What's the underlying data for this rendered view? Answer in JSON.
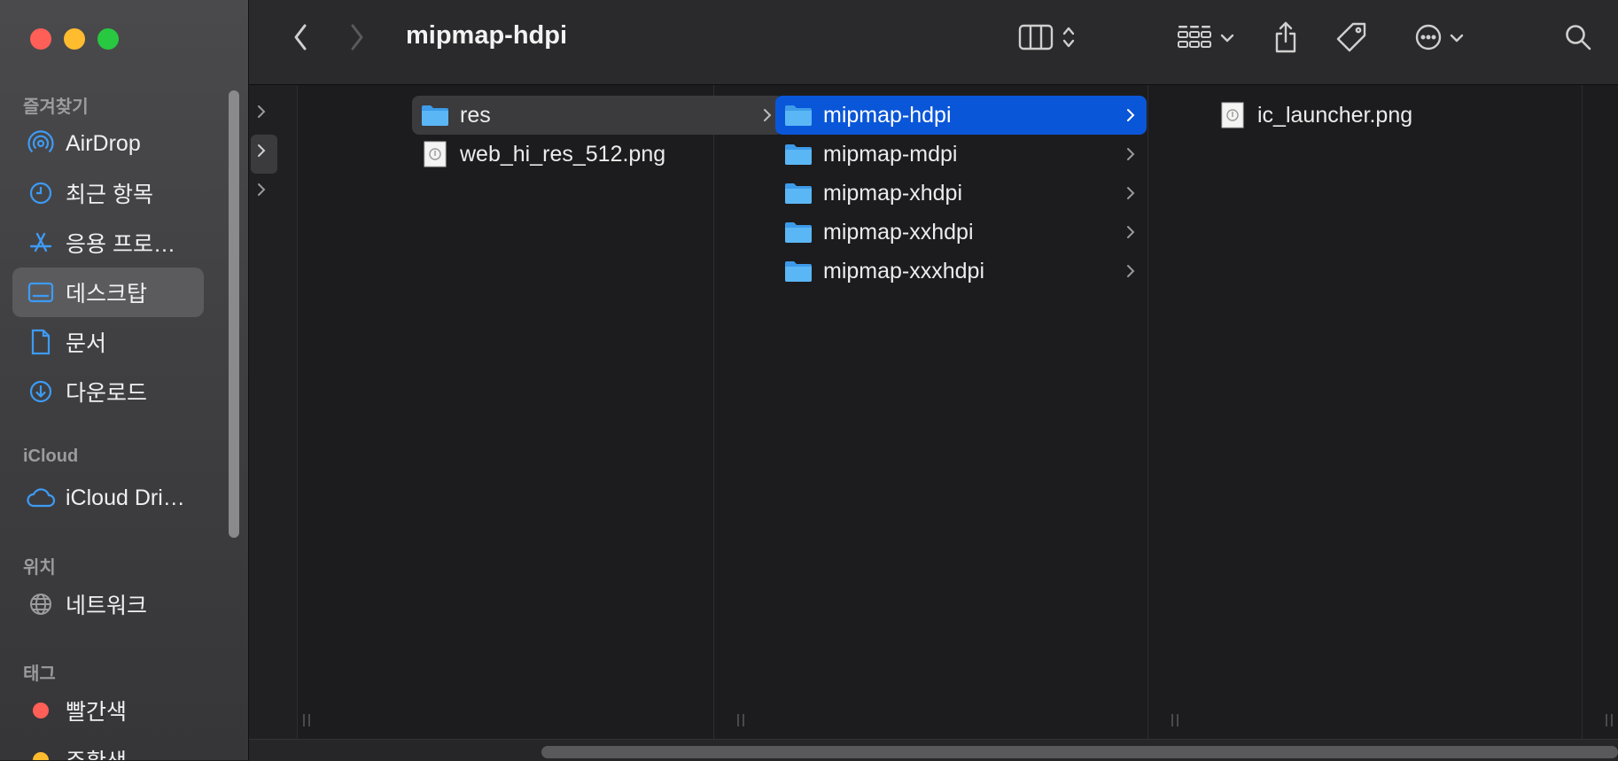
{
  "window": {
    "title": "mipmap-hdpi"
  },
  "sidebar": {
    "sections": {
      "favorites": "즐겨찾기",
      "icloud": "iCloud",
      "locations": "위치",
      "tags": "태그"
    },
    "favorites": [
      {
        "label": "AirDrop",
        "icon": "airdrop-icon"
      },
      {
        "label": "최근 항목",
        "icon": "clock-icon"
      },
      {
        "label": "응용 프로…",
        "icon": "applications-icon"
      },
      {
        "label": "데스크탑",
        "icon": "desktop-icon",
        "selected": true
      },
      {
        "label": "문서",
        "icon": "document-icon"
      },
      {
        "label": "다운로드",
        "icon": "download-icon"
      }
    ],
    "icloud": [
      {
        "label": "iCloud Dri…",
        "icon": "cloud-icon"
      }
    ],
    "locations": [
      {
        "label": "네트워크",
        "icon": "network-globe-icon"
      }
    ],
    "tags": [
      {
        "label": "빨간색",
        "color": "#ff5f57"
      },
      {
        "label": "주황색",
        "color": "#febc2e"
      }
    ]
  },
  "toolbar": {
    "back": "chevron-left-icon",
    "forward": "chevron-right-icon",
    "view": "column-view-icon",
    "group": "grid-group-icon",
    "share": "share-icon",
    "tag": "tag-icon",
    "more": "ellipsis-circle-icon",
    "search": "search-icon"
  },
  "columns": [
    {
      "items": [
        {
          "name": "res",
          "kind": "folder",
          "selected": "inactive",
          "chevron": true
        },
        {
          "name": "web_hi_res_512.png",
          "kind": "png"
        }
      ]
    },
    {
      "items": [
        {
          "name": "mipmap-hdpi",
          "kind": "folder",
          "selected": "active",
          "chevron": true
        },
        {
          "name": "mipmap-mdpi",
          "kind": "folder",
          "chevron": true
        },
        {
          "name": "mipmap-xhdpi",
          "kind": "folder",
          "chevron": true
        },
        {
          "name": "mipmap-xxhdpi",
          "kind": "folder",
          "chevron": true
        },
        {
          "name": "mipmap-xxxhdpi",
          "kind": "folder",
          "chevron": true
        }
      ]
    },
    {
      "items": [
        {
          "name": "ic_launcher.png",
          "kind": "png"
        }
      ]
    }
  ],
  "colors": {
    "selection_active": "#0a56d8",
    "selection_inactive": "#3b3b3d",
    "folder": "#41a6ee"
  }
}
